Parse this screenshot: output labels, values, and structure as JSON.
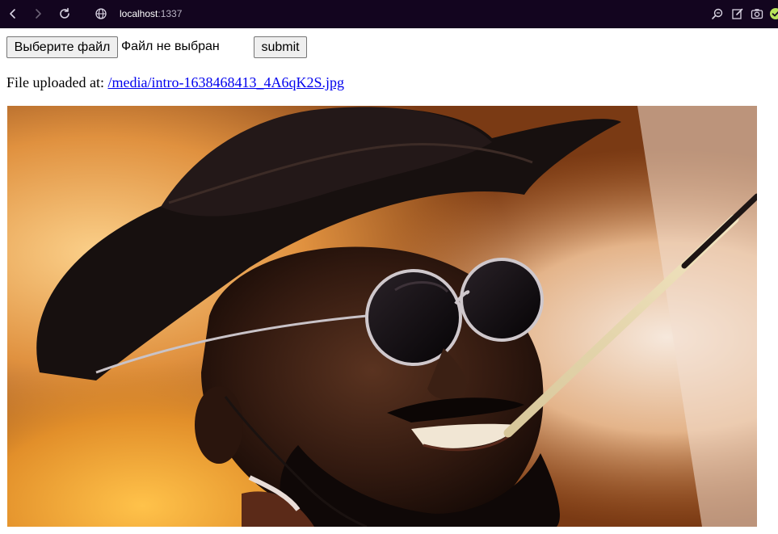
{
  "browser": {
    "host": "localhost",
    "port": ":1337",
    "icons": {
      "back": "back-arrow-icon",
      "forward": "forward-arrow-icon",
      "reload": "reload-icon",
      "site": "globe-icon",
      "zoom": "zoom-icon",
      "edit": "edit-icon",
      "screenshot": "camera-icon",
      "shield": "shield-check-icon"
    }
  },
  "form": {
    "choose_file_label": "Выберите файл",
    "no_file_text": "Файл не выбран",
    "submit_label": "submit"
  },
  "upload": {
    "prefix": "File uploaded at:",
    "link_text": "/media/intro-1638468413_4A6qK2S.jpg"
  },
  "colors": {
    "toolbar_bg": "#13051f",
    "link": "#0000ee"
  }
}
